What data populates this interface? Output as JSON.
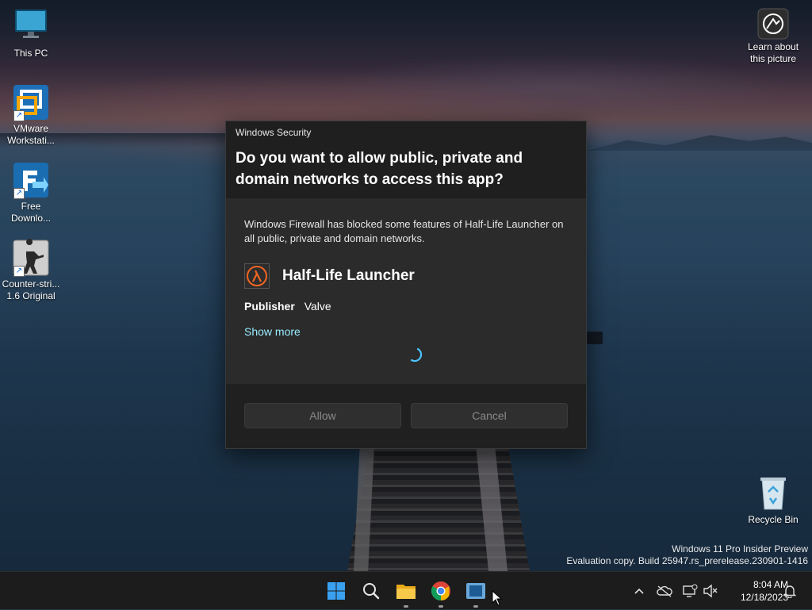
{
  "desktop": {
    "icons": [
      {
        "label": "This PC",
        "icon": "monitor-icon"
      },
      {
        "label": "VMware Workstati...",
        "icon": "vmware-icon"
      },
      {
        "label": "Free Downlo...",
        "icon": "download-manager-icon"
      },
      {
        "label": "Counter-stri... 1.6 Original",
        "icon": "counter-strike-icon"
      },
      {
        "label": "Learn about this picture",
        "icon": "camera-icon"
      },
      {
        "label": "Recycle Bin",
        "icon": "recycle-bin-icon"
      }
    ]
  },
  "dialog": {
    "app_title": "Windows Security",
    "question": "Do you want to allow public, private and domain networks to access this app?",
    "description": "Windows Firewall has blocked some features of Half-Life Launcher on all public, private and domain networks.",
    "app_name": "Half-Life Launcher",
    "publisher_label": "Publisher",
    "publisher_value": "Valve",
    "show_more": "Show more",
    "allow_label": "Allow",
    "cancel_label": "Cancel"
  },
  "watermark": {
    "line1": "Windows 11 Pro Insider Preview",
    "line2": "Evaluation copy. Build 25947.rs_prerelease.230901-1416"
  },
  "taskbar": {
    "apps": [
      "start-icon",
      "search-icon",
      "file-explorer-icon",
      "chrome-icon",
      "windows-security-icon"
    ],
    "tray": [
      "chevron-up-icon",
      "onedrive-icon",
      "network-icon",
      "volume-muted-icon",
      "notification-bell-icon"
    ],
    "time": "8:04 AM",
    "date": "12/18/2023"
  },
  "colors": {
    "accent_link": "#99ebff",
    "dialog_bg": "#2b2b2b",
    "taskbar_bg": "#1c1c1c",
    "halflife_orange": "#f26522"
  }
}
